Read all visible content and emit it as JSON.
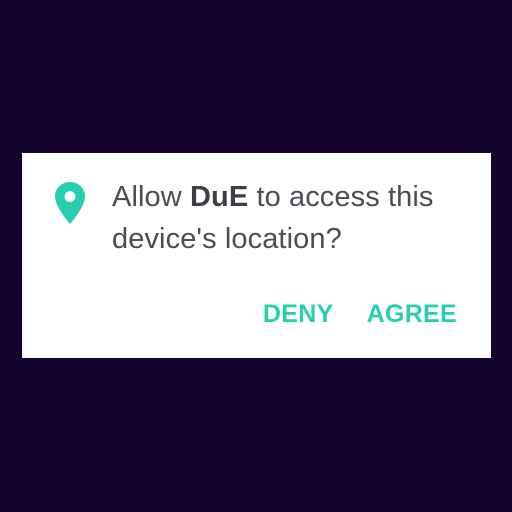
{
  "dialog": {
    "icon": "location-pin-icon",
    "message_prefix": "Allow ",
    "app_name": "DuE",
    "message_suffix": " to access this device's location?",
    "deny_label": "DENY",
    "agree_label": "AGREE"
  },
  "colors": {
    "background": "#140430",
    "dialog": "#ffffff",
    "accent": "#27cfb0",
    "text": "#4a4d53"
  }
}
